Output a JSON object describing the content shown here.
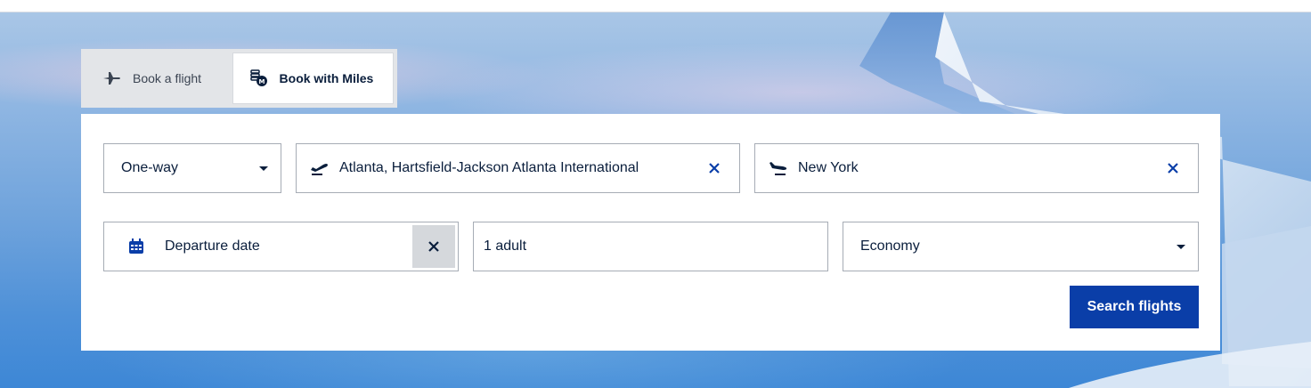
{
  "tabs": [
    {
      "label": "Book a flight",
      "icon": "airplane-icon",
      "active": false
    },
    {
      "label": "Book with Miles",
      "icon": "miles-coins-icon",
      "active": true
    }
  ],
  "form": {
    "trip_type": {
      "value": "One-way"
    },
    "origin": {
      "value": "Atlanta, Hartsfield-Jackson Atlanta International",
      "icon": "takeoff-icon"
    },
    "destination": {
      "value": "New York",
      "icon": "landing-icon"
    },
    "departure_date": {
      "placeholder": "Departure date",
      "icon": "calendar-icon"
    },
    "passengers": {
      "value": "1 adult"
    },
    "cabin": {
      "value": "Economy"
    },
    "search_label": "Search flights"
  },
  "colors": {
    "primary_button": "#0a3ea8",
    "text": "#0a1e3c",
    "tab_bar": "#e3e5e8",
    "field_border": "#a6acb5"
  }
}
